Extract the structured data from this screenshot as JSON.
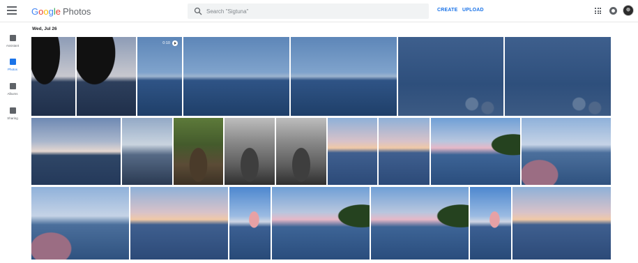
{
  "header": {
    "logo_google": [
      "G",
      "o",
      "o",
      "g",
      "l",
      "e"
    ],
    "logo_product": "Photos",
    "search_placeholder": "Search \"Sigtuna\"",
    "create_label": "CREATE",
    "upload_label": "UPLOAD"
  },
  "sidebar": {
    "items": [
      {
        "label": "Assistant",
        "icon": "assistant-icon"
      },
      {
        "label": "Photos",
        "icon": "photos-icon",
        "active": true
      },
      {
        "label": "Albums",
        "icon": "albums-icon"
      },
      {
        "label": "Sharing",
        "icon": "sharing-icon"
      }
    ]
  },
  "section": {
    "date": "Wed, Jul 26"
  },
  "video_badge": {
    "duration": "0:10",
    "icon": "play-icon"
  },
  "colors": {
    "accent": "#1a73e8",
    "icon_gray": "#5f6368"
  }
}
